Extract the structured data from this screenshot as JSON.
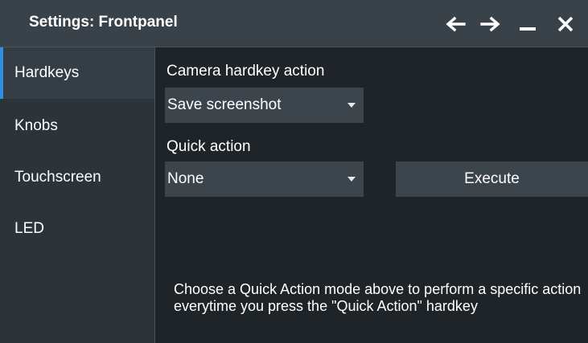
{
  "window": {
    "title": "Settings: Frontpanel",
    "controls": {
      "back_icon": "arrow-left-icon",
      "forward_icon": "arrow-right-icon",
      "minimize_icon": "minimize-icon",
      "close_icon": "close-icon"
    }
  },
  "sidebar": {
    "items": [
      {
        "label": "Hardkeys",
        "active": true
      },
      {
        "label": "Knobs",
        "active": false
      },
      {
        "label": "Touchscreen",
        "active": false
      },
      {
        "label": "LED",
        "active": false
      }
    ]
  },
  "main": {
    "camera": {
      "label": "Camera hardkey action",
      "value": "Save screenshot"
    },
    "quick": {
      "label": "Quick action",
      "value": "None",
      "execute_label": "Execute"
    },
    "help_text": "Choose a Quick Action mode above to perform a specific action everytime you press the \"Quick Action\" hardkey"
  },
  "colors": {
    "accent": "#2f8fe0",
    "background": "#1f2428",
    "titlebar": "#3a4249",
    "control": "#3d454c"
  }
}
